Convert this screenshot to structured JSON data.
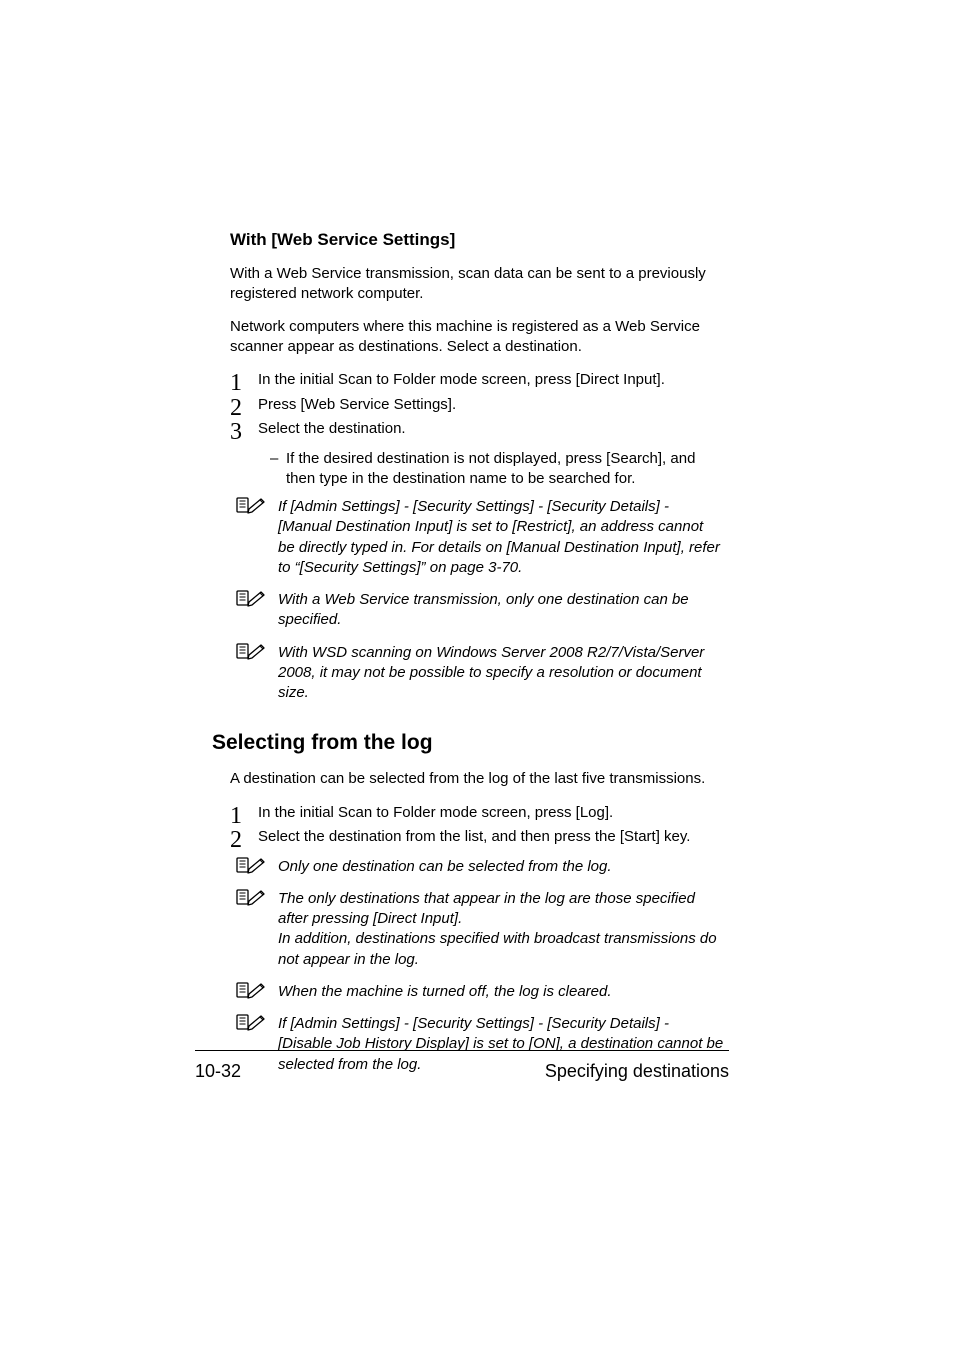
{
  "section1": {
    "heading": "With [Web Service Settings]",
    "para1": "With a Web Service transmission, scan data can be sent to a previously registered network computer.",
    "para2": "Network computers where this machine is registered as a Web Service scanner appear as destinations. Select a destination.",
    "steps": {
      "s1": "In the initial Scan to Folder mode screen, press [Direct Input].",
      "s2": "Press [Web Service Settings].",
      "s3": "Select the destination."
    },
    "sub_bullet": "If the desired destination is not displayed, press [Search], and then type in the destination name to be searched for.",
    "note1": "If [Admin Settings] - [Security Settings] - [Security Details] - [Manual Destination Input] is set to [Restrict], an address cannot be directly typed in. For details on [Manual Destination Input], refer to “[Security Settings]” on page 3-70.",
    "note2": "With a Web Service transmission, only one destination can be specified.",
    "note3": "With WSD scanning on Windows Server 2008 R2/7/Vista/Server 2008, it may not be possible to specify a resolution or document size."
  },
  "section2": {
    "heading": "Selecting from the log",
    "para1": "A destination can be selected from the log of the last five transmissions.",
    "steps": {
      "s1": "In the initial Scan to Folder mode screen, press [Log].",
      "s2": "Select the destination from the list, and then press the [Start] key."
    },
    "note1": "Only one destination can be selected from the log.",
    "note2a": "The only destinations that appear in the log are those specified after pressing [Direct Input].",
    "note2b": "In addition, destinations specified with broadcast transmissions do not appear in the log.",
    "note3": "When the machine is turned off, the log is cleared.",
    "note4": "If [Admin Settings] - [Security Settings] - [Security Details] - [Disable Job History Display] is set to [ON], a destination cannot be selected from the log."
  },
  "footer": {
    "page_number": "10-32",
    "title": "Specifying destinations"
  }
}
